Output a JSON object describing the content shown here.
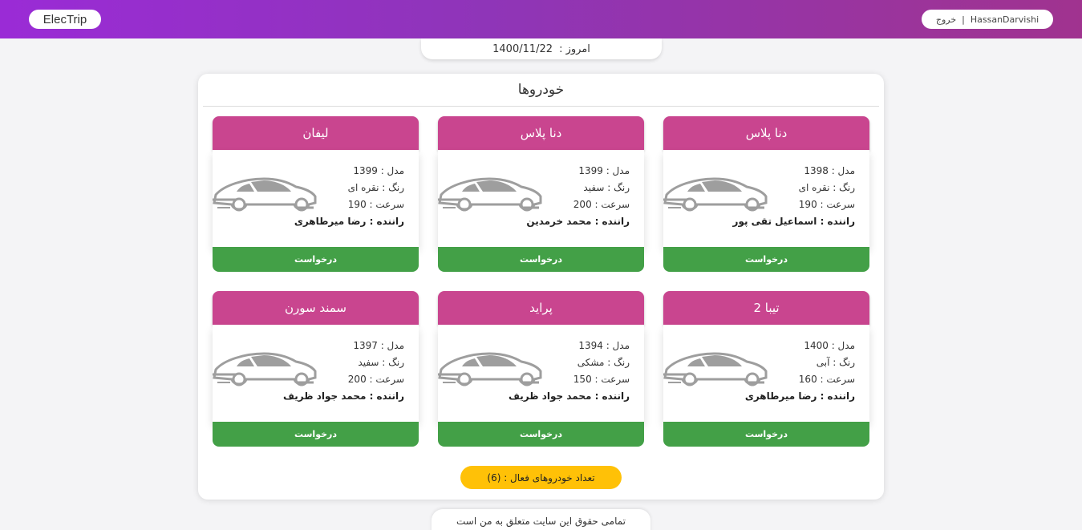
{
  "header": {
    "brand": "ElecTrip",
    "username": "HassanDarvishi",
    "separator": "|",
    "logout": "خروج"
  },
  "date_bar": {
    "label": "امروز :",
    "value": "1400/11/22"
  },
  "panel": {
    "title": "خودروها"
  },
  "cars": [
    {
      "name": "دنا پلاس",
      "model": "مدل : 1398",
      "color": "رنگ : نقره ای",
      "speed": "سرعت : 190",
      "driver": "راننده : اسماعیل تقی پور",
      "button": "درخواست"
    },
    {
      "name": "دنا پلاس",
      "model": "مدل : 1399",
      "color": "رنگ : سفید",
      "speed": "سرعت : 200",
      "driver": "راننده : محمد خرمدین",
      "button": "درخواست"
    },
    {
      "name": "لیفان",
      "model": "مدل : 1399",
      "color": "رنگ : نقره ای",
      "speed": "سرعت : 190",
      "driver": "راننده : رضا میرطاهری",
      "button": "درخواست"
    },
    {
      "name": "تیبا 2",
      "model": "مدل : 1400",
      "color": "رنگ : آبی",
      "speed": "سرعت : 160",
      "driver": "راننده : رضا میرطاهری",
      "button": "درخواست"
    },
    {
      "name": "پراید",
      "model": "مدل : 1394",
      "color": "رنگ : مشکی",
      "speed": "سرعت : 150",
      "driver": "راننده : محمد جواد ظریف",
      "button": "درخواست"
    },
    {
      "name": "سمند سورن",
      "model": "مدل : 1397",
      "color": "رنگ : سفید",
      "speed": "سرعت : 200",
      "driver": "راننده : محمد جواد ظریف",
      "button": "درخواست"
    }
  ],
  "active_count": "تعداد خودروهای فعال : (6)",
  "footer": "تمامی حقوق این سایت متعلق به من است",
  "colors": {
    "header_gradient_start": "#9a2bd6",
    "header_gradient_end": "#a0338f",
    "card_header": "#c9458f",
    "request_button": "#43a047",
    "count_pill": "#ffc107",
    "car_icon": "#9e9e9e"
  },
  "icons": {
    "car": "car-silhouette-icon"
  }
}
